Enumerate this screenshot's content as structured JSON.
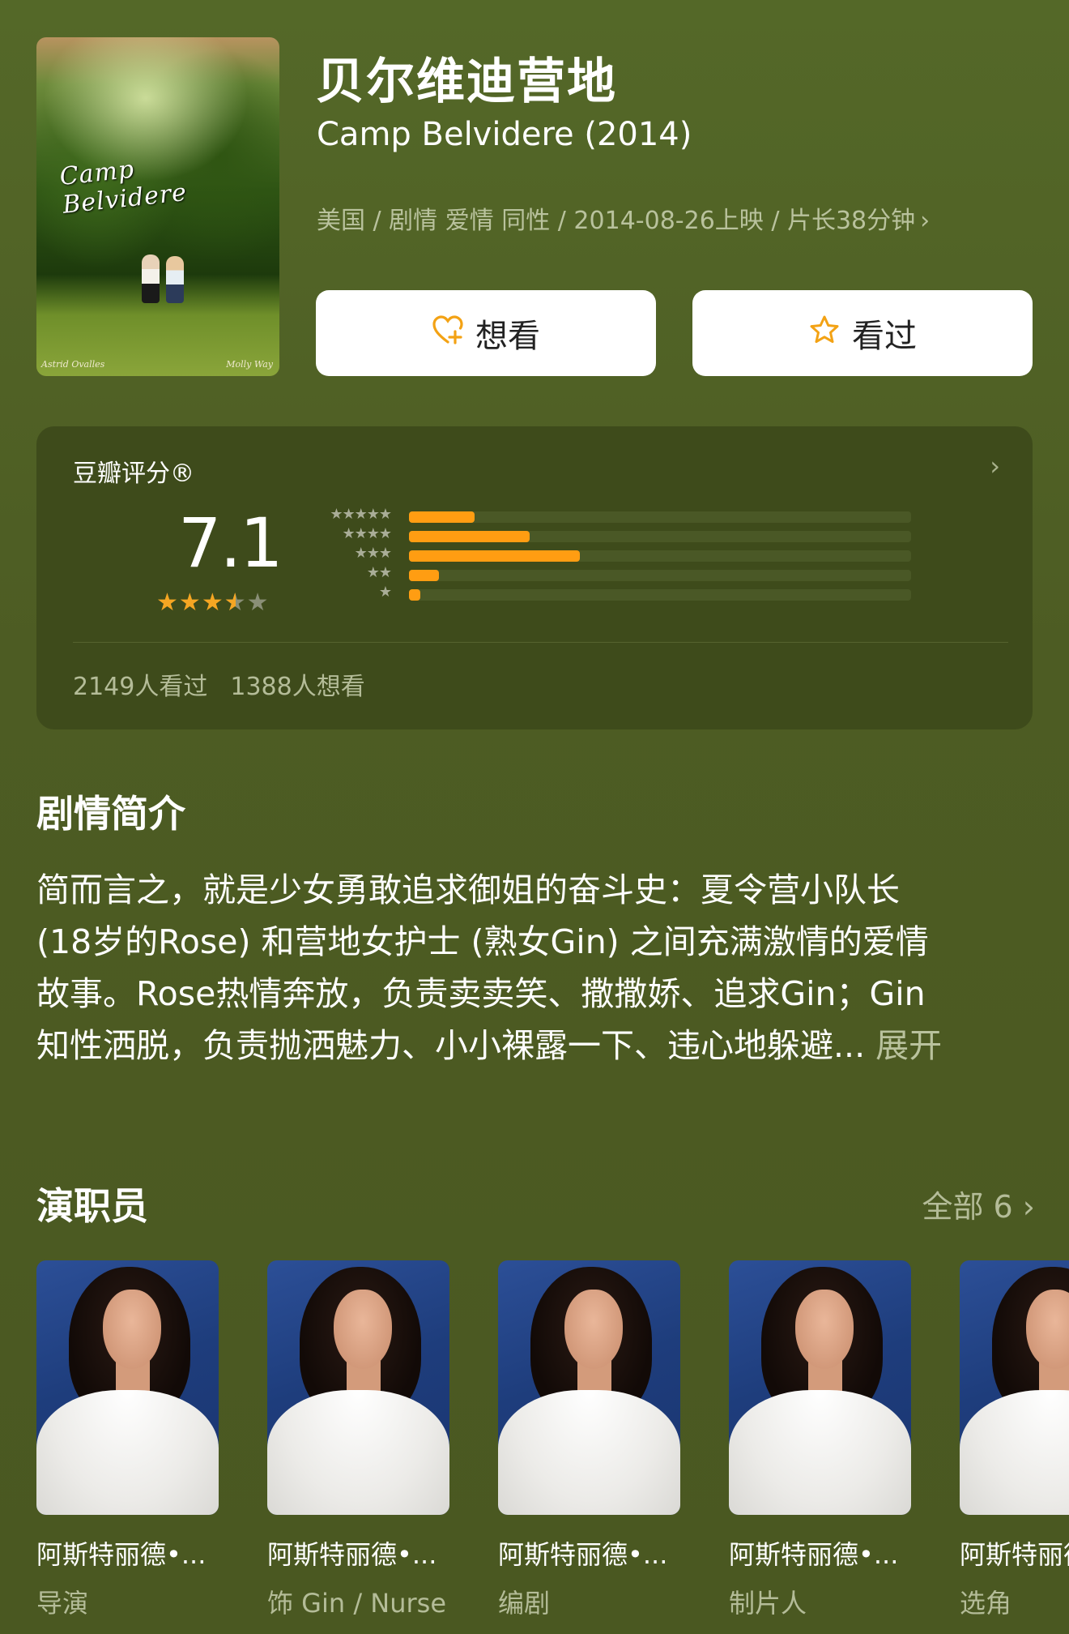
{
  "movie": {
    "title_cn": "贝尔维迪营地",
    "title_en": "Camp Belvidere (2014)",
    "meta": "美国 / 剧情 爱情 同性 / 2014-08-26上映 / 片长38分钟",
    "meta_chevron": "chevron-right-icon"
  },
  "poster": {
    "title": "Camp Belvidere",
    "credit_left": "Astrid Ovalles",
    "credit_right": "Molly Way"
  },
  "actions": {
    "want_label": "想看",
    "want_icon": "heart-plus-icon",
    "watched_label": "看过",
    "watched_icon": "star-outline-icon"
  },
  "rating": {
    "label": "豆瓣评分®",
    "score": "7.1",
    "stars_display": 3.5,
    "distribution": [
      {
        "stars": 5,
        "fraction": 0.13
      },
      {
        "stars": 4,
        "fraction": 0.24
      },
      {
        "stars": 3,
        "fraction": 0.34
      },
      {
        "stars": 2,
        "fraction": 0.06
      },
      {
        "stars": 1,
        "fraction": 0.02
      }
    ],
    "watched_count": "2149人看过",
    "want_count": "1388人想看",
    "accent_color": "#ff9d12"
  },
  "synopsis": {
    "title": "剧情简介",
    "lines": [
      "简而言之，就是少女勇敢追求御姐的奋斗史：夏令营小队长",
      "(18岁的Rose) 和营地女护士 (熟女Gin) 之间充满激情的爱情",
      "故事。Rose热情奔放，负责卖卖笑、撒撒娇、追求Gin；Gin",
      "知性洒脱，负责抛洒魅力、小小裸露一下、违心地躲避..."
    ],
    "expand_label": "展开"
  },
  "cast": {
    "title": "演职员",
    "all_label": "全部 6",
    "members": [
      {
        "name": "阿斯特丽德•...",
        "role": "导演"
      },
      {
        "name": "阿斯特丽德•...",
        "role": "饰 Gin / Nurse"
      },
      {
        "name": "阿斯特丽德•...",
        "role": "编剧"
      },
      {
        "name": "阿斯特丽德•...",
        "role": "制片人"
      },
      {
        "name": "阿斯特丽德",
        "role": "选角"
      }
    ]
  }
}
